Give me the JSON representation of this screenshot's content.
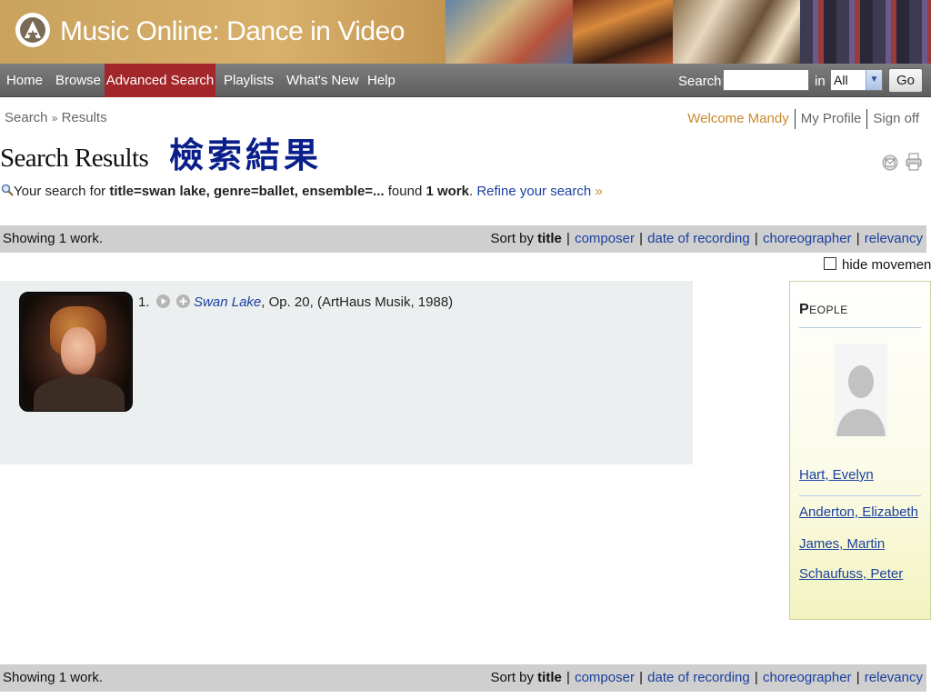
{
  "header": {
    "title": "Music Online: Dance in Video"
  },
  "nav": {
    "items": [
      {
        "label": "Home"
      },
      {
        "label": "Browse"
      },
      {
        "label": "Advanced Search",
        "active": true
      },
      {
        "label": "Playlists"
      },
      {
        "label": "What's New"
      },
      {
        "label": "Help"
      }
    ],
    "search_label": "Search:",
    "search_value": "",
    "in_label": "in",
    "scope_selected": "All",
    "go_label": "Go"
  },
  "breadcrumb": {
    "root": "Search",
    "separator": "»",
    "current": "Results"
  },
  "user": {
    "welcome": "Welcome Mandy",
    "profile": "My Profile",
    "signoff": "Sign off"
  },
  "page": {
    "title": "Search Results",
    "annotation": "檢索結果"
  },
  "summary": {
    "prefix": "Your search for ",
    "query": "title=swan lake, genre=ballet, ensemble=...",
    "found_text": " found ",
    "count": "1 work",
    "refine": "Refine your search",
    "raquo": "»"
  },
  "results_bar": {
    "showing": "Showing 1 work.",
    "sort_by": "Sort by ",
    "sort_options": [
      {
        "label": "title",
        "active": true
      },
      {
        "label": "composer"
      },
      {
        "label": "date of recording"
      },
      {
        "label": "choreographer"
      },
      {
        "label": "relevancy"
      }
    ]
  },
  "hide_movement": {
    "label": "hide movement",
    "checked": false
  },
  "results": [
    {
      "index": "1.",
      "title": "Swan Lake",
      "details": ", Op. 20, (ArtHaus Musik, 1988)"
    }
  ],
  "people": {
    "heading_first": "P",
    "heading_rest": "EOPLE",
    "names": [
      "Hart, Evelyn",
      "Anderton, Elizabeth",
      "James, Martin",
      "Schaufuss, Peter"
    ]
  }
}
